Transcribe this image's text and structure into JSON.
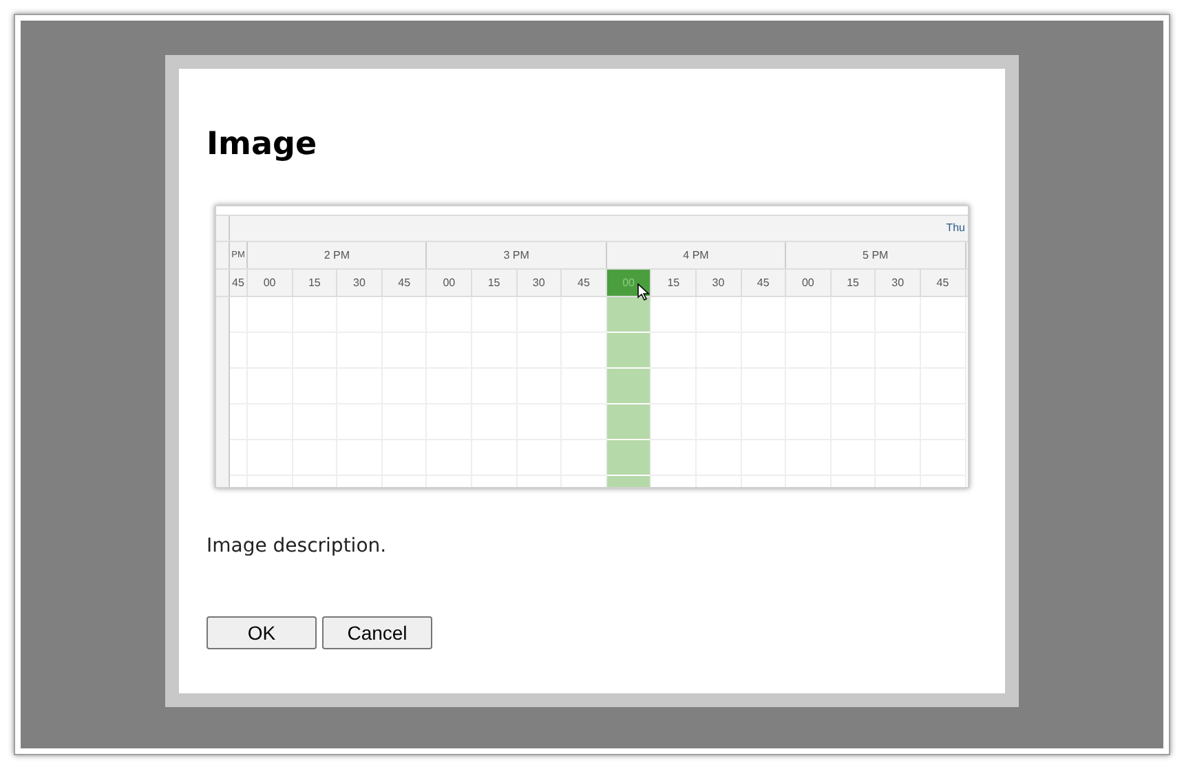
{
  "dialog": {
    "title": "Image",
    "image": {
      "day": "Thu",
      "hours": [
        "PM",
        "2 PM",
        "3 PM",
        "4 PM",
        "5 PM"
      ],
      "slots": [
        {
          "label": "45",
          "selected": false
        },
        {
          "label": "00",
          "selected": false
        },
        {
          "label": "15",
          "selected": false
        },
        {
          "label": "30",
          "selected": false
        },
        {
          "label": "45",
          "selected": false
        },
        {
          "label": "00",
          "selected": false
        },
        {
          "label": "15",
          "selected": false
        },
        {
          "label": "30",
          "selected": false
        },
        {
          "label": "45",
          "selected": false
        },
        {
          "label": "00",
          "selected": true
        },
        {
          "label": "15",
          "selected": false
        },
        {
          "label": "30",
          "selected": false
        },
        {
          "label": "45",
          "selected": false
        },
        {
          "label": "00",
          "selected": false
        },
        {
          "label": "15",
          "selected": false
        },
        {
          "label": "30",
          "selected": false
        },
        {
          "label": "45",
          "selected": false
        }
      ]
    },
    "description": "Image description.",
    "buttons": [
      {
        "label": "OK"
      },
      {
        "label": "Cancel"
      }
    ]
  }
}
